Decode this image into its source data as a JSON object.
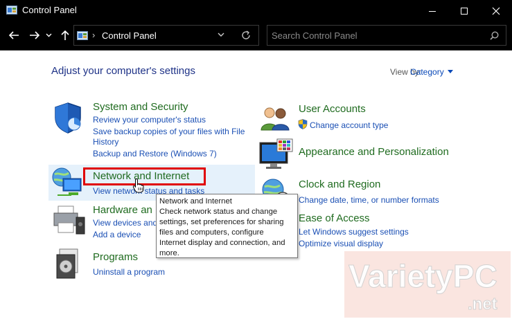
{
  "window": {
    "title": "Control Panel",
    "minimize_icon": "minimize-icon",
    "maximize_icon": "maximize-icon",
    "close_icon": "close-icon"
  },
  "address_bar": {
    "breadcrumb": "Control Panel",
    "separator": "›",
    "search_placeholder": "Search Control Panel"
  },
  "header": {
    "title": "Adjust your computer's settings",
    "view_by_label": "View by:",
    "view_by_value": "Category"
  },
  "categories": {
    "system": {
      "title": "System and Security",
      "links": [
        "Review your computer's status",
        "Save backup copies of your files with File",
        "History",
        "Backup and Restore (Windows 7)"
      ]
    },
    "network": {
      "title": "Network and Internet",
      "links": [
        "View network status and tasks"
      ]
    },
    "hardware": {
      "title": "Hardware and Sound",
      "title_visible": "Hardware an",
      "links": [
        "View devices and printers",
        "Add a device"
      ],
      "links_visible": [
        "View devices and"
      ]
    },
    "programs": {
      "title": "Programs",
      "links": [
        "Uninstall a program"
      ]
    },
    "user_accounts": {
      "title": "User Accounts",
      "links": [
        "Change account type"
      ]
    },
    "appearance": {
      "title": "Appearance and Personalization"
    },
    "clock": {
      "title": "Clock and Region",
      "links": [
        "Change date, time, or number formats"
      ]
    },
    "ease": {
      "title": "Ease of Access",
      "links": [
        "Let Windows suggest settings",
        "Optimize visual display"
      ]
    }
  },
  "tooltip": {
    "lines": [
      "Network and Internet",
      "Check network status and change",
      "settings, set preferences for sharing",
      "files and computers, configure",
      "Internet display and connection, and",
      "more."
    ]
  },
  "watermark": {
    "brand": "VarietyPC",
    "domain": ".net"
  },
  "colors": {
    "title_bar": "#000000",
    "heading": "#1e3287",
    "category_title": "#1f6b1f",
    "link": "#1a4fb4",
    "highlight": "#e5f1fb",
    "focus_box": "#e00000"
  }
}
